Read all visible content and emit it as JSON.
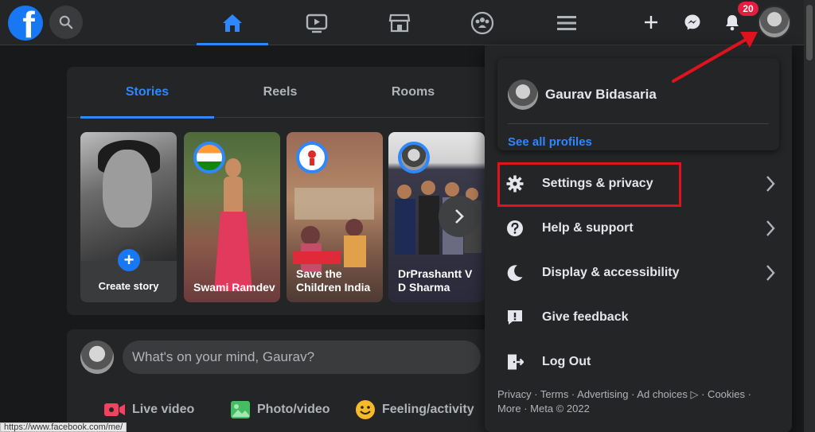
{
  "topbar": {
    "logo_letter": "f",
    "nav_tabs": [
      "home-icon",
      "watch-icon",
      "marketplace-icon",
      "groups-icon",
      "menu-icon"
    ],
    "notification_count": "20"
  },
  "stories": {
    "tabs": [
      {
        "label": "Stories",
        "active": true
      },
      {
        "label": "Reels",
        "active": false
      },
      {
        "label": "Rooms",
        "active": false
      }
    ],
    "create_label": "Create story",
    "items": [
      {
        "name": "Swami Ramdev"
      },
      {
        "name": "Save the Children India"
      },
      {
        "name": "DrPrashantt V D Sharma"
      }
    ]
  },
  "composer": {
    "placeholder": "What's on your mind, Gaurav?",
    "actions": [
      {
        "label": "Live video",
        "color": "#f3425f"
      },
      {
        "label": "Photo/video",
        "color": "#45bd62"
      },
      {
        "label": "Feeling/activity",
        "color": "#f7b928"
      }
    ]
  },
  "menu": {
    "profile_name": "Gaurav Bidasaria",
    "see_all": "See all profiles",
    "items": [
      {
        "label": "Settings & privacy",
        "icon": "gear-icon",
        "chevron": true
      },
      {
        "label": "Help & support",
        "icon": "question-icon",
        "chevron": true
      },
      {
        "label": "Display & accessibility",
        "icon": "moon-icon",
        "chevron": true
      },
      {
        "label": "Give feedback",
        "icon": "feedback-icon",
        "chevron": false
      },
      {
        "label": "Log Out",
        "icon": "logout-icon",
        "chevron": false
      }
    ],
    "footer_line1": "Privacy · Terms · Advertising · Ad choices ▷ · Cookies ·",
    "footer_line2": "More · Meta © 2022"
  },
  "status_url": "https://www.facebook.com/me/",
  "colors": {
    "accent": "#2d88ff",
    "brand": "#1877f2",
    "highlight": "#e0121d",
    "badge": "#e41e3f"
  }
}
